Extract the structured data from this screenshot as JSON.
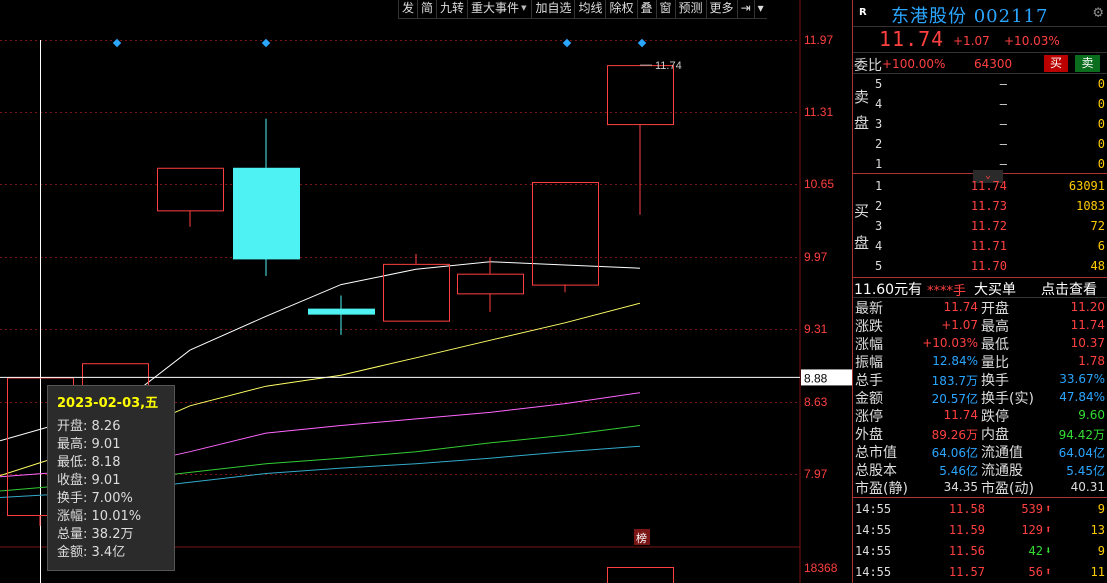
{
  "toolbar": {
    "items": [
      "发",
      "简",
      "九转",
      "重大事件",
      "加自选",
      "均线",
      "除权",
      "叠",
      "窗",
      "预测",
      "更多"
    ],
    "dropdown_items": [
      3
    ]
  },
  "chart": {
    "y_ticks": [
      "11.97",
      "11.31",
      "10.65",
      "9.97",
      "9.31",
      "8.63",
      "7.97"
    ],
    "crosshair_price": "8.88",
    "volume_tick": "18368",
    "high_label": "11.74",
    "bang_label": "榜"
  },
  "chart_data": {
    "type": "candlestick",
    "candles": [
      {
        "open": 7.62,
        "close": 8.88,
        "high": 8.88,
        "low": 7.52,
        "color": "red"
      },
      {
        "open": 8.26,
        "close": 9.01,
        "high": 9.01,
        "low": 8.18,
        "color": "red"
      },
      {
        "open": 10.41,
        "close": 10.8,
        "high": 10.8,
        "low": 10.26,
        "color": "red"
      },
      {
        "open": 10.8,
        "close": 9.97,
        "high": 11.25,
        "low": 9.81,
        "color": "cyan"
      },
      {
        "open": 9.51,
        "close": 9.51,
        "high": 9.63,
        "low": 9.27,
        "color": "cyan"
      },
      {
        "open": 9.4,
        "close": 9.92,
        "high": 10.01,
        "low": 9.4,
        "color": "red"
      },
      {
        "open": 9.65,
        "close": 9.83,
        "high": 9.98,
        "low": 9.48,
        "color": "red"
      },
      {
        "open": 9.73,
        "close": 10.67,
        "high": 10.67,
        "low": 9.66,
        "color": "red"
      },
      {
        "open": 11.2,
        "close": 11.74,
        "high": 11.74,
        "low": 10.37,
        "color": "red"
      }
    ],
    "ma_series": [
      {
        "color": "#ffffff",
        "values": [
          8.3,
          8.6,
          9.13,
          9.44,
          9.73,
          9.87,
          9.94,
          9.91,
          9.88,
          10.2
        ]
      },
      {
        "color": "#ffff66",
        "values": [
          7.98,
          8.32,
          8.62,
          8.8,
          8.9,
          9.06,
          9.22,
          9.38,
          9.56,
          9.82
        ]
      },
      {
        "color": "#ff66ff",
        "values": [
          7.97,
          8.05,
          8.2,
          8.37,
          8.44,
          8.5,
          8.56,
          8.64,
          8.74,
          8.9
        ]
      },
      {
        "color": "#33cc33",
        "values": [
          7.84,
          7.93,
          8.01,
          8.09,
          8.14,
          8.2,
          8.28,
          8.35,
          8.44,
          8.55
        ]
      },
      {
        "color": "#33aacc",
        "values": [
          7.78,
          7.84,
          7.92,
          8.0,
          8.05,
          8.09,
          8.14,
          8.2,
          8.25,
          8.32
        ]
      }
    ],
    "ylim": [
      7.6,
      12.1
    ]
  },
  "tooltip": {
    "date": "2023-02-03,五",
    "rows": [
      {
        "label": "开盘",
        "value": "8.26"
      },
      {
        "label": "最高",
        "value": "9.01"
      },
      {
        "label": "最低",
        "value": "8.18"
      },
      {
        "label": "收盘",
        "value": "9.01"
      },
      {
        "label": "换手",
        "value": "7.00%"
      },
      {
        "label": "涨幅",
        "value": "10.01%"
      },
      {
        "label": "总量",
        "value": "38.2万"
      },
      {
        "label": "金额",
        "value": "3.4亿"
      }
    ]
  },
  "quote": {
    "badge": "R",
    "name": "东港股份 002117",
    "price": "11.74",
    "change": "+1.07",
    "change_pct": "+10.03%",
    "weibi_label": "委比",
    "weibi_pct": "+100.00%",
    "weibi_vol": "64300",
    "buy_btn": "买",
    "sell_btn": "卖"
  },
  "asks": {
    "label": [
      "卖",
      "盘"
    ],
    "rows": [
      {
        "level": "5",
        "price": "–",
        "vol": "0"
      },
      {
        "level": "4",
        "price": "–",
        "vol": "0"
      },
      {
        "level": "3",
        "price": "–",
        "vol": "0"
      },
      {
        "level": "2",
        "price": "–",
        "vol": "0"
      },
      {
        "level": "1",
        "price": "–",
        "vol": "0"
      }
    ]
  },
  "bids": {
    "label": [
      "买",
      "盘"
    ],
    "rows": [
      {
        "level": "1",
        "price": "11.74",
        "vol": "63091"
      },
      {
        "level": "2",
        "price": "11.73",
        "vol": "1083"
      },
      {
        "level": "3",
        "price": "11.72",
        "vol": "72"
      },
      {
        "level": "4",
        "price": "11.71",
        "vol": "6"
      },
      {
        "level": "5",
        "price": "11.70",
        "vol": "48"
      }
    ]
  },
  "big_order": {
    "price_text": "11.60元有",
    "stars": "****手",
    "type": "大买单",
    "link": "点击查看"
  },
  "stats": [
    {
      "k1": "最新",
      "v1": "11.74",
      "c1": "#ff4040",
      "k2": "开盘",
      "v2": "11.20",
      "c2": "#ff4040"
    },
    {
      "k1": "涨跌",
      "v1": "+1.07",
      "c1": "#ff4040",
      "k2": "最高",
      "v2": "11.74",
      "c2": "#ff4040"
    },
    {
      "k1": "涨幅",
      "v1": "+10.03%",
      "c1": "#ff4040",
      "k2": "最低",
      "v2": "10.37",
      "c2": "#ff4040"
    },
    {
      "k1": "振幅",
      "v1": "12.84%",
      "c1": "#2aa6ff",
      "k2": "量比",
      "v2": "1.78",
      "c2": "#ff4040"
    },
    {
      "k1": "总手",
      "v1": "183.7万",
      "c1": "#2aa6ff",
      "k2": "换手",
      "v2": "33.67%",
      "c2": "#2aa6ff"
    },
    {
      "k1": "金额",
      "v1": "20.57亿",
      "c1": "#2aa6ff",
      "k2": "换手(实)",
      "v2": "47.84%",
      "c2": "#2aa6ff"
    },
    {
      "k1": "涨停",
      "v1": "11.74",
      "c1": "#ff4040",
      "k2": "跌停",
      "v2": "9.60",
      "c2": "#33dd33"
    },
    {
      "k1": "外盘",
      "v1": "89.26万",
      "c1": "#ff4040",
      "k2": "内盘",
      "v2": "94.42万",
      "c2": "#33dd33"
    },
    {
      "k1": "总市值",
      "v1": "64.06亿",
      "c1": "#2aa6ff",
      "k2": "流通值",
      "v2": "64.04亿",
      "c2": "#2aa6ff"
    },
    {
      "k1": "总股本",
      "v1": "5.46亿",
      "c1": "#2aa6ff",
      "k2": "流通股",
      "v2": "5.45亿",
      "c2": "#2aa6ff"
    },
    {
      "k1": "市盈(静)",
      "v1": "34.35",
      "c1": "#ddd",
      "k2": "市盈(动)",
      "v2": "40.31",
      "c2": "#ddd"
    }
  ],
  "ticks": [
    {
      "time": "14:55",
      "price": "11.58",
      "vol": "539",
      "dir": "up",
      "n": "9"
    },
    {
      "time": "14:55",
      "price": "11.59",
      "vol": "129",
      "dir": "up",
      "n": "13"
    },
    {
      "time": "14:55",
      "price": "11.56",
      "vol": "42",
      "dir": "down",
      "n": "9"
    },
    {
      "time": "14:55",
      "price": "11.57",
      "vol": "56",
      "dir": "up",
      "n": "11"
    }
  ],
  "colors": {
    "up": "#ff4040",
    "down": "#33dd33",
    "cyan": "#4ff2f2",
    "grid": "#7a1515"
  }
}
